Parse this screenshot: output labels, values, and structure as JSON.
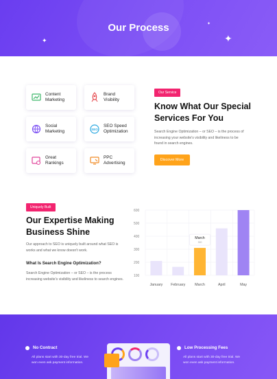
{
  "hero": {
    "title": "Our Process"
  },
  "services": [
    {
      "label_1": "Content",
      "label_2": "Marketing",
      "icon": "content-marketing-icon"
    },
    {
      "label_1": "Brand",
      "label_2": "Visibility",
      "icon": "rocket-icon"
    },
    {
      "label_1": "Social",
      "label_2": "Marketing",
      "icon": "social-globe-icon"
    },
    {
      "label_1": "SEO Speed",
      "label_2": "Optimization",
      "icon": "seo-speed-icon"
    },
    {
      "label_1": "Great",
      "label_2": "Rankings",
      "icon": "rankings-icon"
    },
    {
      "label_1": "PPC",
      "label_2": "Advertising",
      "icon": "ppc-advertising-icon"
    }
  ],
  "service_intro": {
    "badge": "Our Service",
    "heading_line1": "Know What Our Special",
    "heading_line2": "Services For You",
    "text_line1": "Search Engine Optimization – or SEO – is the process of",
    "text_line2": "increasing your website's visibility and likeliness to be",
    "text_line3": "found in search engines.",
    "button": "Discover More"
  },
  "expertise": {
    "badge": "Uniquely Built",
    "heading_line1": "Our Expertise Making",
    "heading_line2": "Business Shine",
    "text_line1": "Our approach to SEO is uniquely built around what SEO is",
    "text_line2": "works and what we know doesn't work.",
    "subheading": "What Is Search Engine Optimization?",
    "sub_text_line1": "Search Engine Optimization – or SEO – is the process",
    "sub_text_line2": "increasing website's visibility and likeliness to search engines."
  },
  "chart_data": {
    "type": "bar",
    "categories": [
      "January",
      "February",
      "March",
      "April",
      "May"
    ],
    "values": [
      210,
      165,
      310,
      460,
      600
    ],
    "yticks": [
      "600",
      "500",
      "400",
      "300",
      "200",
      "100"
    ],
    "ylim": [
      100,
      600
    ],
    "highlight_index": 2,
    "tooltip": {
      "title": "March",
      "value": "300"
    },
    "colors": {
      "bar": "#e9e4fb",
      "highlight": "#ffb533",
      "accent": "#9f84f3"
    }
  },
  "features": [
    {
      "title": "No Contract",
      "line1": "All plans start with 30-day free trial. We",
      "line2": "won even ask payment information."
    },
    {
      "title": "Low Processing Fees",
      "line1": "All plans start with 30-day free trial. We",
      "line2": "won even ask payment information."
    }
  ],
  "colors": {
    "primary": "#6c3ff2",
    "pink": "#f2246f",
    "orange": "#ffa31a"
  }
}
